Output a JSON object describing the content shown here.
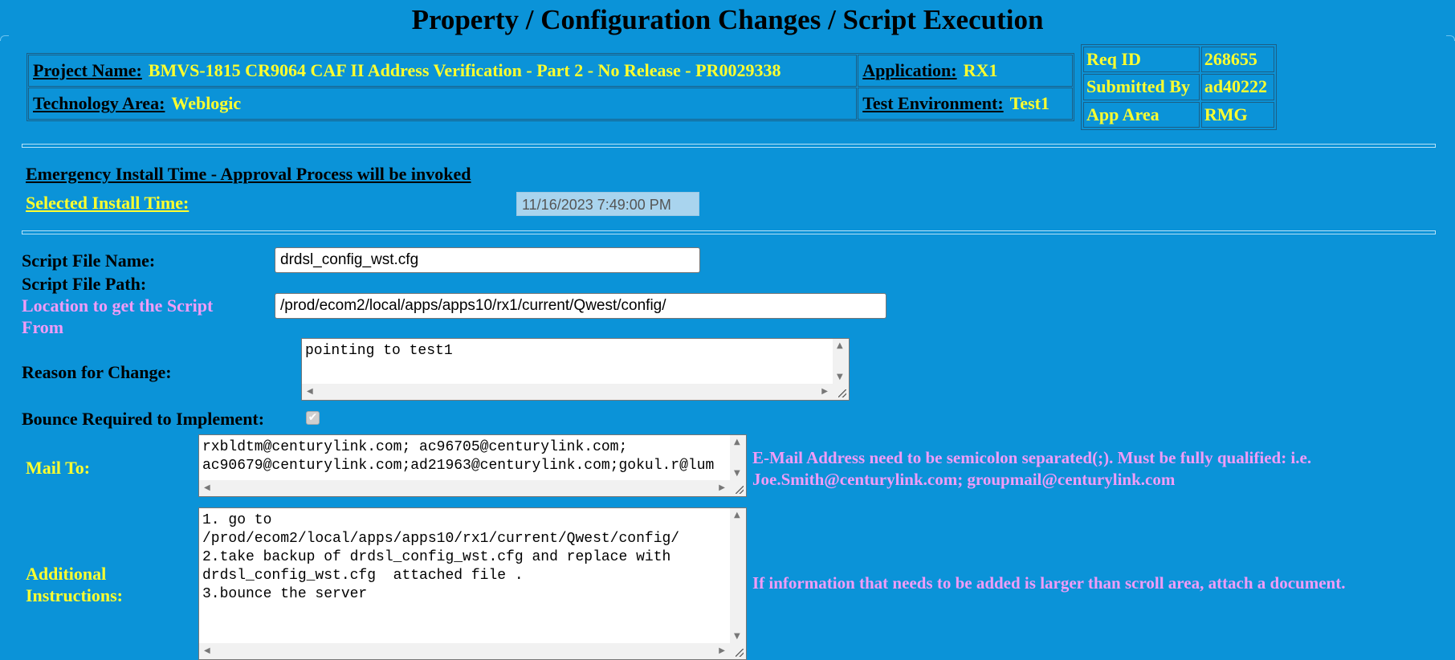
{
  "title": "Property / Configuration Changes / Script Execution",
  "header": {
    "project_label": "Project Name:",
    "project_value": "BMVS-1815 CR9064 CAF II Address Verification - Part 2 - No Release - PR0029338",
    "application_label": "Application:",
    "application_value": "RX1",
    "tech_label": "Technology Area:",
    "tech_value": "Weblogic",
    "env_label": "Test Environment:",
    "env_value": "Test1"
  },
  "request": {
    "rows": [
      {
        "label": "Req ID",
        "value": "268655"
      },
      {
        "label": "Submitted By",
        "value": "ad40222"
      },
      {
        "label": "App Area",
        "value": "RMG"
      }
    ]
  },
  "install": {
    "emergency_text": "Emergency Install Time - Approval Process will be invoked",
    "selected_label": "Selected Install Time:",
    "selected_value": "11/16/2023 7:49:00 PM"
  },
  "form": {
    "script_name_label": "Script File Name:",
    "script_name_value": "drdsl_config_wst.cfg",
    "script_path_label": "Script File Path:",
    "location_label": "Location to get the Script From",
    "location_value": "/prod/ecom2/local/apps/apps10/rx1/current/Qwest/config/",
    "reason_label": "Reason for Change:",
    "reason_value": "pointing to test1",
    "bounce_label": "Bounce Required to Implement:",
    "bounce_checked": true,
    "mail_label": "Mail To:",
    "mail_value": "rxbldtm@centurylink.com; ac96705@centurylink.com;\nac90679@centurylink.com;ad21963@centurylink.com;gokul.r@lum",
    "mail_note": "E-Mail Address need to be semicolon separated(;). Must be fully qualified: i.e. Joe.Smith@centurylink.com; groupmail@centurylink.com",
    "instructions_label": "Additional Instructions:",
    "instructions_value": "1. go to\n/prod/ecom2/local/apps/apps10/rx1/current/Qwest/config/\n2.take backup of drdsl_config_wst.cfg and replace with\ndrdsl_config_wst.cfg  attached file .\n3.bounce the server",
    "instructions_note": "If information that needs to be added is larger than scroll area, attach a document."
  },
  "colors": {
    "background": "#0b93d8",
    "value_yellow": "#ffff2e",
    "note_pink": "#f09cf7"
  }
}
